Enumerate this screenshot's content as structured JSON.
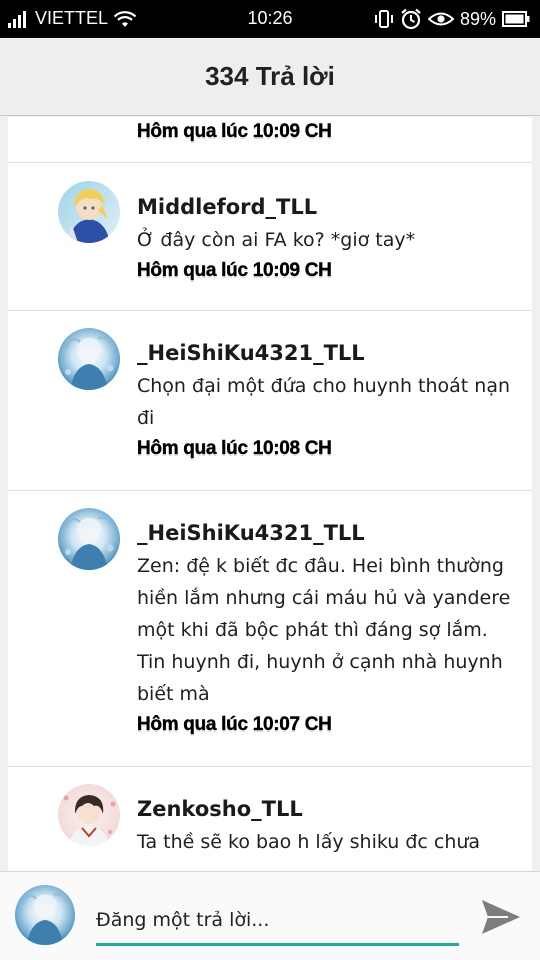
{
  "status_bar": {
    "carrier": "VIETTEL",
    "time": "10:26",
    "battery": "89%"
  },
  "header": {
    "title": "334 Trả lời"
  },
  "replies": [
    {
      "author": "",
      "message": "",
      "time": "Hôm qua lúc 10:09 CH",
      "avatar": ""
    },
    {
      "author": "Middleford_TLL",
      "message": "Ở đây còn ai FA ko? *giơ tay*",
      "time": "Hôm qua lúc 10:09 CH",
      "avatar": "blonde-knight-avatar"
    },
    {
      "author": "_HeiShiKu4321_TLL",
      "message": "Chọn đại một đứa cho huynh thoát nạn đi",
      "time": "Hôm qua lúc 10:08 CH",
      "avatar": "blue-white-anime-avatar"
    },
    {
      "author": "_HeiShiKu4321_TLL",
      "message": "Zen: đệ k biết đc đâu. Hei bình thường hiền lắm nhưng cái máu hủ và yandere một khi đã bộc phát thì đáng sợ lắm. Tin huynh đi, huynh ở cạnh nhà huynh biết mà",
      "time": "Hôm qua lúc 10:07 CH",
      "avatar": "blue-white-anime-avatar"
    },
    {
      "author": "Zenkosho_TLL",
      "message": "Ta thề sẽ ko bao h lấy shiku đc chưa",
      "time": "",
      "avatar": "dark-hair-boy-avatar"
    }
  ],
  "composer": {
    "placeholder": "Đăng một trả lời...",
    "accent_color": "#26a69a",
    "send_icon": "send-icon"
  },
  "colors": {
    "header_bg": "#eeeeee",
    "list_bg": "#ffffff",
    "page_bg": "#f0f0f0"
  }
}
